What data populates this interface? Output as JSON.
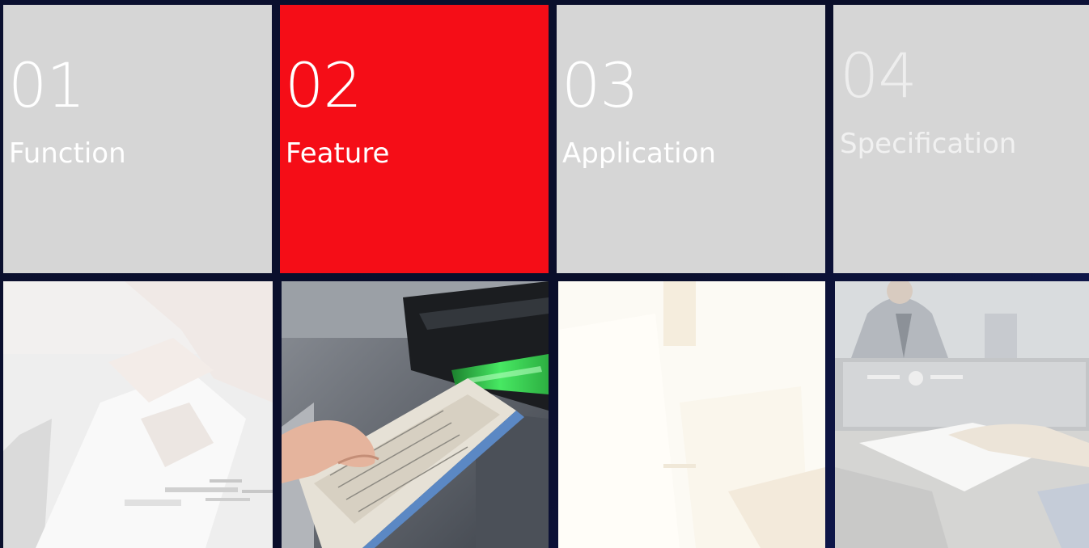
{
  "tabs": [
    {
      "number": "01",
      "label": "Function",
      "active": false
    },
    {
      "number": "02",
      "label": "Feature",
      "active": true
    },
    {
      "number": "03",
      "label": "Application",
      "active": false
    },
    {
      "number": "04",
      "label": "Specification",
      "active": false
    }
  ],
  "colors": {
    "background": "#0a0f2e",
    "tile_inactive": "#d6d6d6",
    "tile_active": "#f50d17",
    "text": "#ffffff"
  },
  "photos": [
    {
      "name": "hand-holding-document-photo"
    },
    {
      "name": "check-scanner-with-green-light-photo"
    },
    {
      "name": "faded-document-photo"
    },
    {
      "name": "person-with-monitor-and-document-photo"
    }
  ]
}
